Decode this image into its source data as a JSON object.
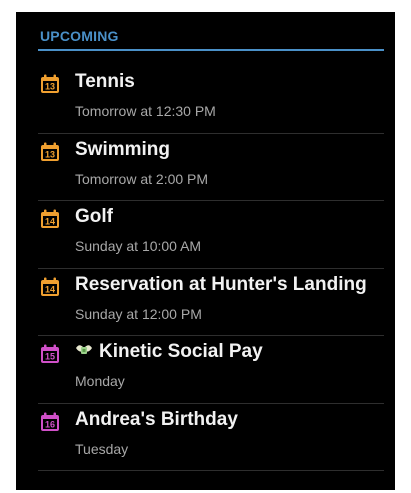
{
  "header": {
    "label": "UPCOMING"
  },
  "colors": {
    "accent": "#4a90c8",
    "orange_calendar": "#f0a030",
    "pink_calendar": "#d050c8",
    "background": "#000000",
    "title_text": "#f2f2f2",
    "subtitle_text": "#a8a8a8"
  },
  "events": [
    {
      "day": "13",
      "title": "Tennis",
      "subtitle": "Tomorrow at 12:30 PM",
      "icon": "calendar-icon",
      "color": "orange"
    },
    {
      "day": "13",
      "title": "Swimming",
      "subtitle": "Tomorrow at 2:00 PM",
      "icon": "calendar-icon",
      "color": "orange"
    },
    {
      "day": "14",
      "title": "Golf",
      "subtitle": "Sunday at 10:00 AM",
      "icon": "calendar-icon",
      "color": "orange"
    },
    {
      "day": "14",
      "title": "Reservation at Hunter's Landing",
      "subtitle": "Sunday at 12:00 PM",
      "icon": "calendar-icon",
      "color": "orange"
    },
    {
      "day": "15",
      "title": "Kinetic Social Pay",
      "subtitle": "Monday",
      "icon": "calendar-icon",
      "color": "pink",
      "emoji": "money-wings-icon"
    },
    {
      "day": "16",
      "title": "Andrea's Birthday",
      "subtitle": "Tuesday",
      "icon": "calendar-icon",
      "color": "pink"
    }
  ]
}
